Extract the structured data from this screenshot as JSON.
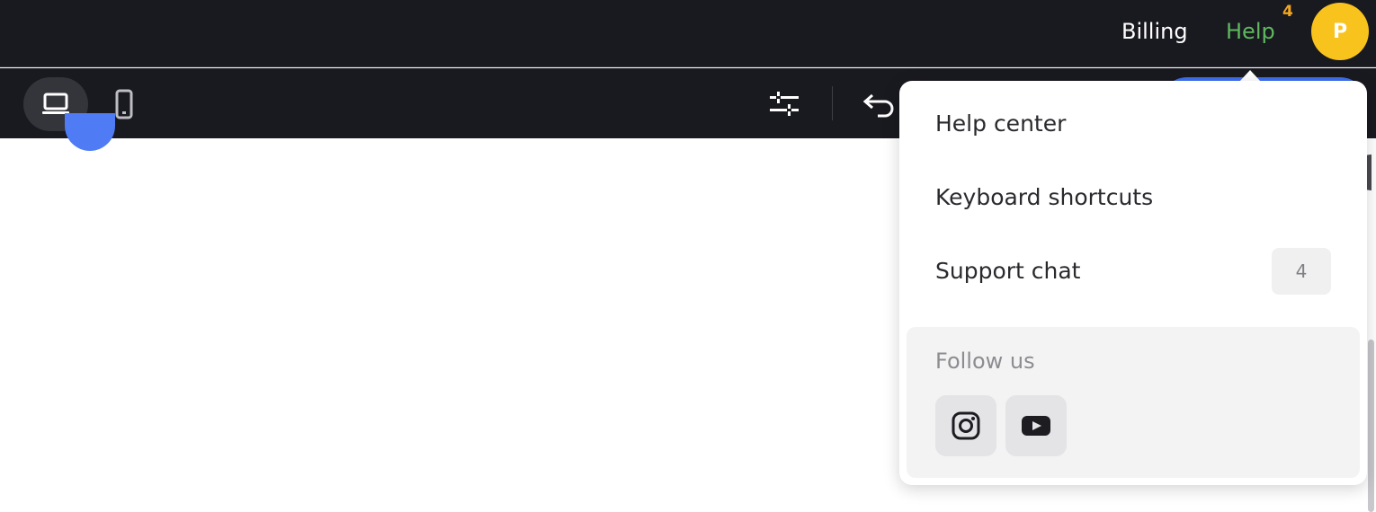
{
  "topbar": {
    "billing_label": "Billing",
    "help_label": "Help",
    "help_badge": "4",
    "avatar_initial": "P",
    "help_color": "#5fb85f",
    "badge_color": "#f2a51f",
    "avatar_color": "#f8c31c"
  },
  "toolbar": {
    "device_desktop_icon": "laptop-icon",
    "device_mobile_icon": "phone-icon",
    "settings_icon": "sliders-icon",
    "undo_icon": "undo-icon",
    "accent_color": "#3f6ff0"
  },
  "help_menu": {
    "items": [
      {
        "label": "Help center"
      },
      {
        "label": "Keyboard shortcuts"
      },
      {
        "label": "Support chat",
        "count": "4"
      }
    ],
    "follow": {
      "title": "Follow us",
      "icons": [
        "instagram-icon",
        "youtube-icon"
      ]
    }
  }
}
